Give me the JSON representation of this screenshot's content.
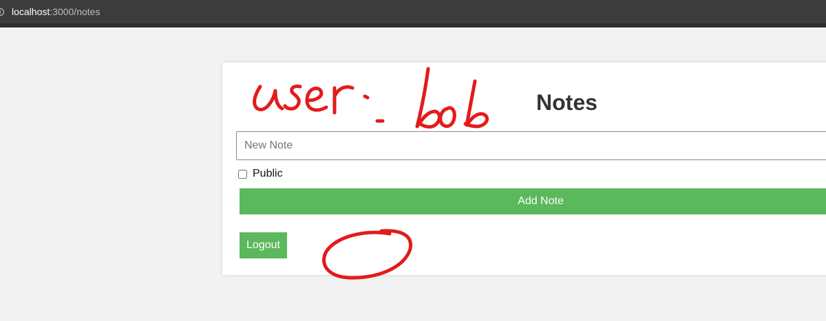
{
  "browser": {
    "url_host": "localhost",
    "url_path": ":3000/notes",
    "info_icon": "info-icon"
  },
  "page": {
    "title": "Notes",
    "new_note_placeholder": "New Note",
    "new_note_value": "",
    "public_label": "Public",
    "public_checked": false,
    "add_note_label": "Add Note",
    "logout_label": "Logout"
  },
  "annotation": {
    "handwritten_text": "user: bob",
    "ink_color": "#e31b1b"
  },
  "colors": {
    "button": "#5cb85c",
    "background": "#f2f2f2",
    "browser_bar": "#3c3c3c"
  }
}
